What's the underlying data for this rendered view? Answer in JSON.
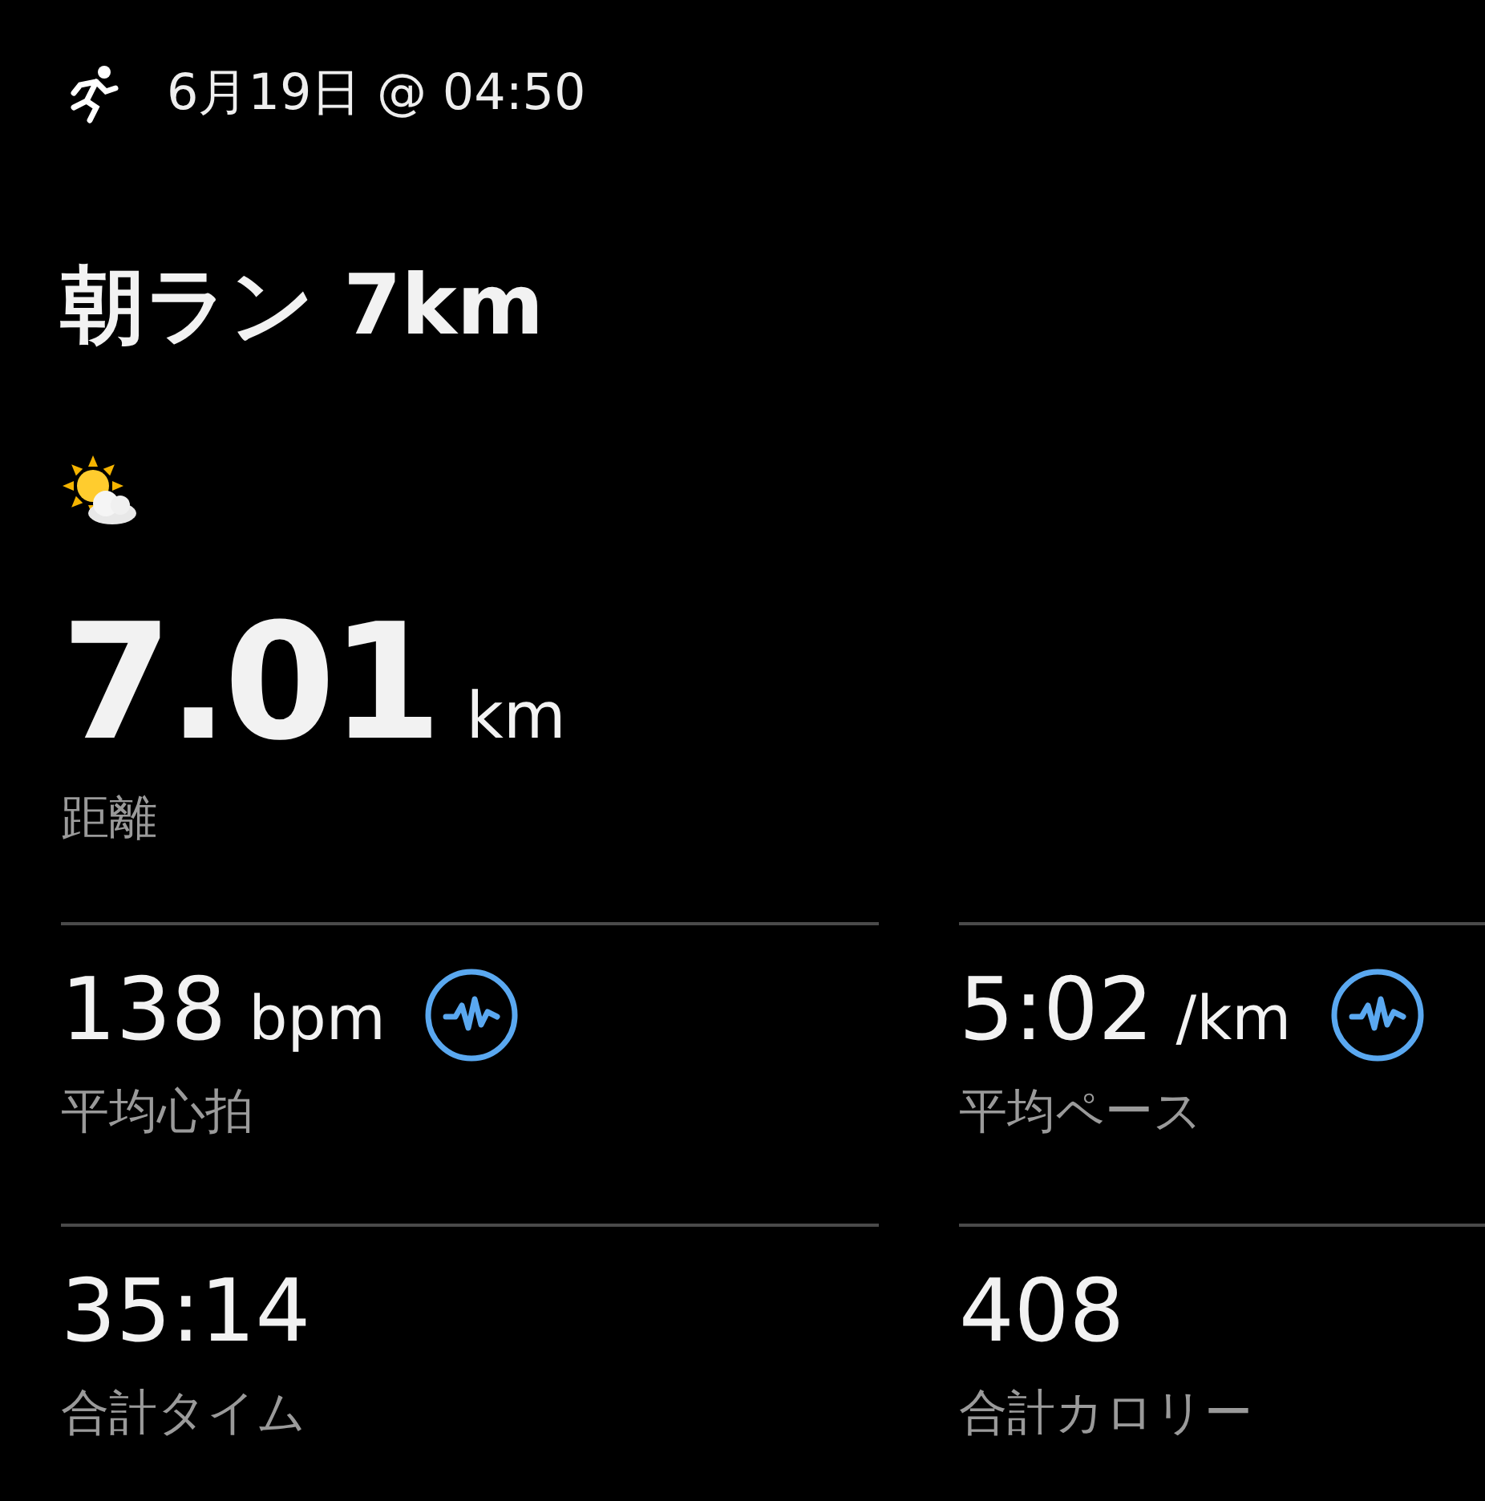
{
  "header": {
    "date_time": "6月19日 @ 04:50"
  },
  "title": "朝ラン 7km",
  "distance": {
    "value": "7.01",
    "unit": "km",
    "label": "距離"
  },
  "stats": [
    {
      "value": "138",
      "unit": "bpm",
      "label": "平均心拍",
      "has_chart": true
    },
    {
      "value": "5:02",
      "unit": "/km",
      "label": "平均ペース",
      "has_chart": true
    },
    {
      "value": "35:14",
      "label": "合計タイム",
      "has_chart": false
    },
    {
      "value": "408",
      "label": "合計カロリー",
      "has_chart": false
    }
  ]
}
